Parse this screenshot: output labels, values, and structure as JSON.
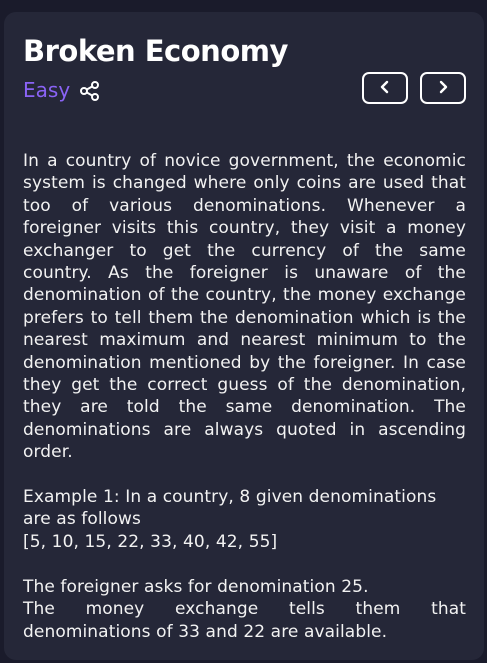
{
  "problem": {
    "title": "Broken Economy",
    "difficulty": "Easy"
  },
  "icons": {
    "share": "share-icon",
    "prev": "chevron-left-icon",
    "next": "chevron-right-icon"
  },
  "colors": {
    "background": "#1a1b2b",
    "panel": "#252738",
    "difficulty_easy": "#8a63f5",
    "text": "#f2f2f2"
  },
  "description": {
    "paragraph1": "In a country of novice government, the economic system is changed where only coins are used that too of various denominations. Whenever a foreigner visits this country, they visit a money exchanger to get the currency of the same country. As the foreigner is unaware of the denomination of the country, the money exchange prefers to tell them the denomination which is the nearest maximum and nearest minimum to the denomination mentioned by the foreigner. In case they get the correct guess of the denomination, they are told the same denomination. The denominations are always quoted in ascending order.",
    "example1_intro": "Example 1: In a country, 8 given denominations are as follows",
    "example1_list": "[5, 10, 15, 22, 33, 40, 42, 55]",
    "example1_ask": "The foreigner asks for denomination 25.",
    "example1_answer": "The money exchange tells them that denominations of 33 and 22 are available."
  }
}
